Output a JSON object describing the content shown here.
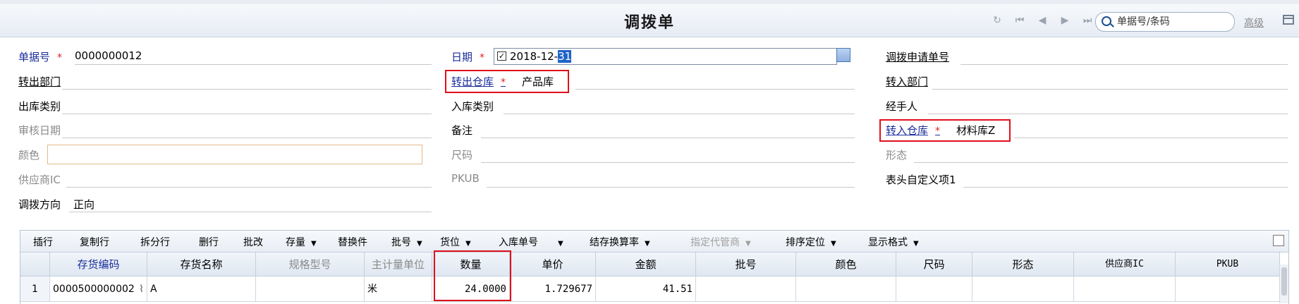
{
  "header": {
    "title": "调拨单",
    "search_placeholder": "单据号/条码",
    "advanced_label": "高级",
    "nav_icons": [
      "refresh-icon",
      "first-page-icon",
      "prev-page-icon",
      "next-page-icon",
      "last-page-icon"
    ]
  },
  "form": {
    "doc_no": {
      "label": "单据号",
      "required": "*",
      "value": "0000000012"
    },
    "date": {
      "label": "日期",
      "required": "*",
      "value_prefix": "2018-12-",
      "value_selected": "31",
      "checked": "✓"
    },
    "transfer_request_no": {
      "label": "调拨申请单号"
    },
    "out_dept": {
      "label": "转出部门"
    },
    "out_warehouse": {
      "label": "转出仓库",
      "required": "*",
      "value": "产品库"
    },
    "in_dept": {
      "label": "转入部门"
    },
    "out_type": {
      "label": "出库类别"
    },
    "in_type": {
      "label": "入库类别"
    },
    "handler": {
      "label": "经手人"
    },
    "audit_date": {
      "label": "审核日期"
    },
    "remark": {
      "label": "备注"
    },
    "in_warehouse": {
      "label": "转入仓库",
      "required": "*",
      "value": "材料库Z"
    },
    "color": {
      "label": "颜色"
    },
    "size": {
      "label": "尺码"
    },
    "form_state": {
      "label": "形态"
    },
    "supplier_ic": {
      "label": "供应商IC"
    },
    "pkub": {
      "label": "PKUB"
    },
    "header_custom1": {
      "label": "表头自定义项1"
    },
    "direction": {
      "label": "调拨方向",
      "value": "正向"
    }
  },
  "toolbar": {
    "insert_row": "插行",
    "copy_row": "复制行",
    "split_row": "拆分行",
    "delete_row": "删行",
    "batch_edit": "批改",
    "stock": "存量",
    "replace": "替换件",
    "batch_no": "批号",
    "location": "货位",
    "in_doc_no": "入库单号",
    "conversion": "结存换算率",
    "agent": "指定代管商",
    "sort_locate": "排序定位",
    "display_format": "显示格式",
    "arrow": "▼"
  },
  "table": {
    "columns": [
      "存货编码",
      "存货名称",
      "规格型号",
      "主计量单位",
      "数量",
      "单价",
      "金额",
      "批号",
      "颜色",
      "尺码",
      "形态",
      "供应商IC",
      "PKUB"
    ],
    "rows": [
      {
        "index": "1",
        "code": "0000500000002",
        "name": "A",
        "spec": "",
        "unit": "米",
        "qty": "24.0000",
        "price": "1.729677",
        "amount": "41.51",
        "batch": "",
        "color": "",
        "size": "",
        "state": "",
        "supplier": "",
        "pkub": ""
      }
    ]
  },
  "colors": {
    "accent_blue": "#1a2e9a",
    "required_red": "#d22222",
    "highlight_red": "#e0101a"
  }
}
